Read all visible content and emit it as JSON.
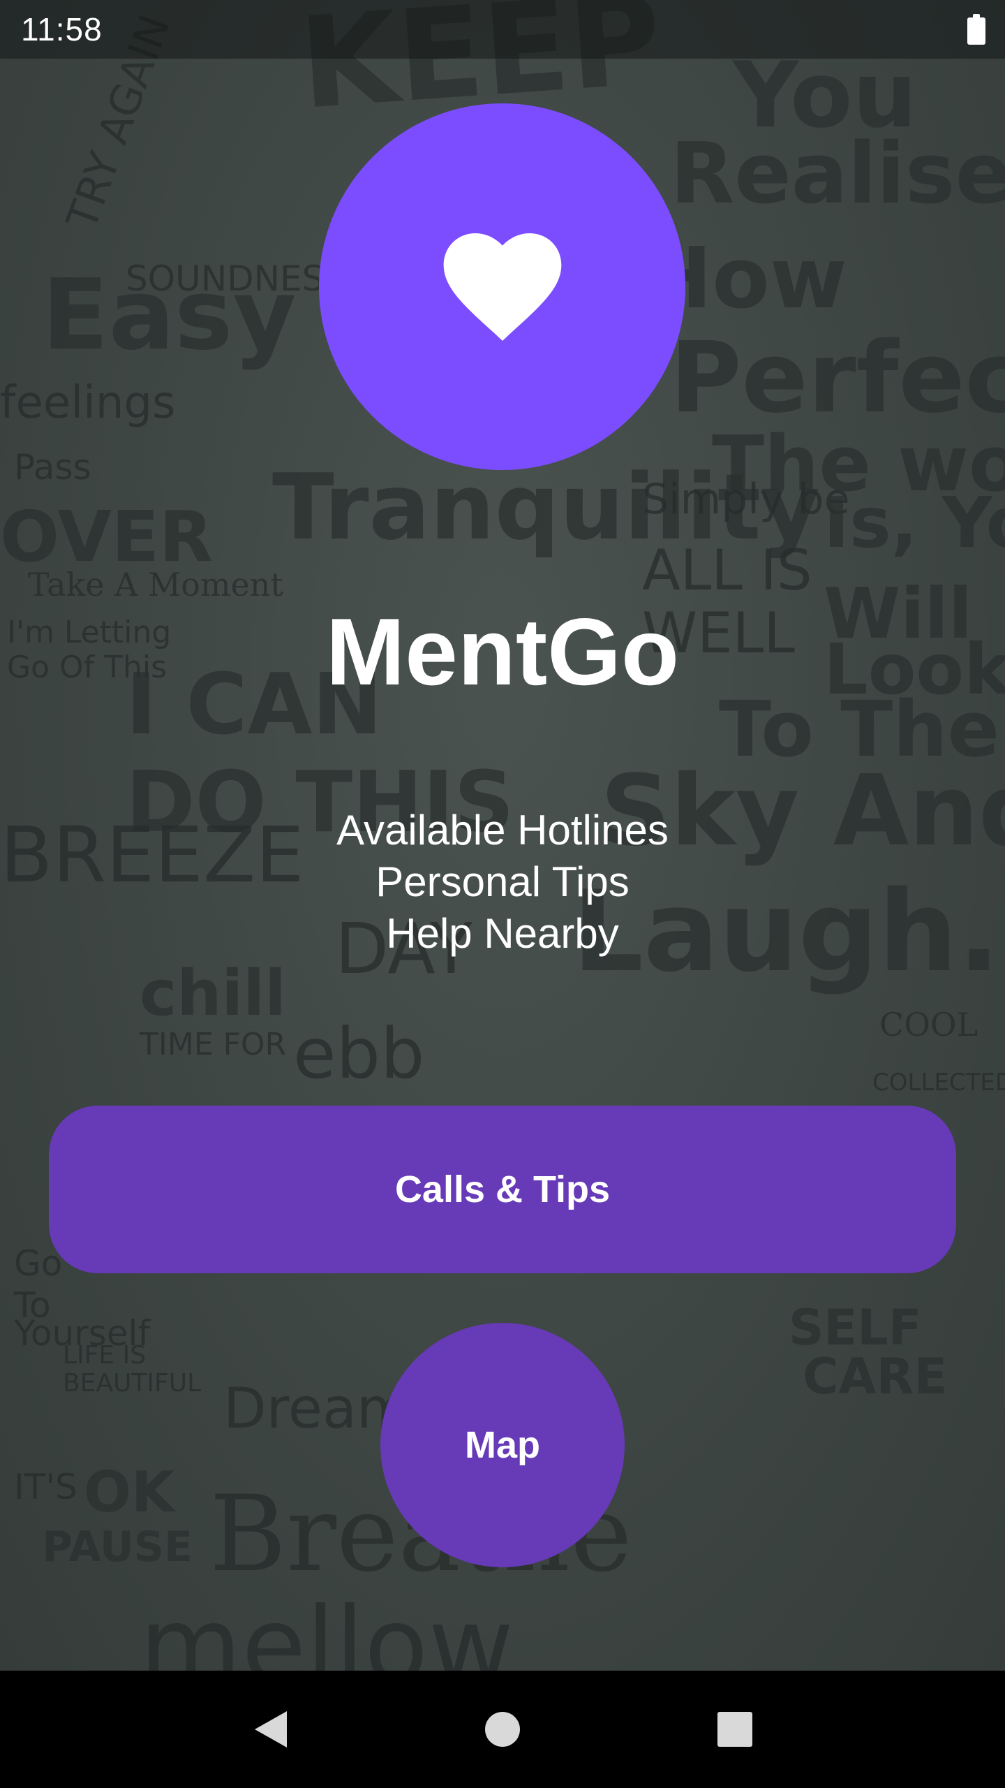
{
  "status_bar": {
    "time": "11:58",
    "battery_icon": "battery-full-icon"
  },
  "app": {
    "logo_icon": "heart-icon",
    "title": "MentGo",
    "features": [
      "Available Hotlines",
      "Personal Tips",
      "Help Nearby"
    ]
  },
  "buttons": {
    "calls_tips": "Calls & Tips",
    "map": "Map"
  },
  "nav_bar": {
    "back_icon": "back-triangle-icon",
    "home_icon": "home-circle-icon",
    "recents_icon": "recents-square-icon"
  },
  "colors": {
    "logo_circle": "#7c4dff",
    "button": "#673ab7",
    "background": "#3e4644"
  }
}
